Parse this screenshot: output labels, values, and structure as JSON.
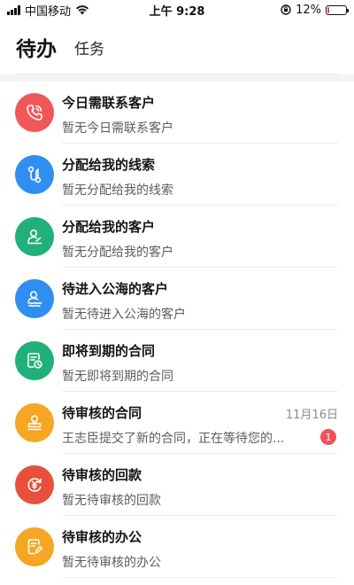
{
  "status_bar": {
    "carrier": "中国移动",
    "time": "上午 9:28",
    "battery_percent": "12%",
    "battery_level": 0.12
  },
  "header": {
    "tab_active": "待办",
    "tab_other": "任务"
  },
  "items": [
    {
      "title": "今日需联系客户",
      "subtitle": "暂无今日需联系客户",
      "icon": "phone-icon",
      "color": "#f0575a"
    },
    {
      "title": "分配给我的线索",
      "subtitle": "暂无分配给我的线索",
      "icon": "route-icon",
      "color": "#2f8ef0"
    },
    {
      "title": "分配给我的客户",
      "subtitle": "暂无分配给我的客户",
      "icon": "user-sign-icon",
      "color": "#21b07a"
    },
    {
      "title": "待进入公海的客户",
      "subtitle": "暂无待进入公海的客户",
      "icon": "user-wave-icon",
      "color": "#2f8ef0"
    },
    {
      "title": "即将到期的合同",
      "subtitle": "暂无即将到期的合同",
      "icon": "contract-clock-icon",
      "color": "#21b07a"
    },
    {
      "title": "待审核的合同",
      "subtitle": "王志臣提交了新的合同，正在等待您的...",
      "icon": "stamp-icon",
      "color": "#f5a623",
      "date": "11月16日",
      "badge": "1"
    },
    {
      "title": "待审核的回款",
      "subtitle": "暂无待审核的回款",
      "icon": "yen-refresh-icon",
      "color": "#e8503c"
    },
    {
      "title": "待审核的办公",
      "subtitle": "暂无待审核的办公",
      "icon": "document-edit-icon",
      "color": "#f5a623"
    }
  ]
}
